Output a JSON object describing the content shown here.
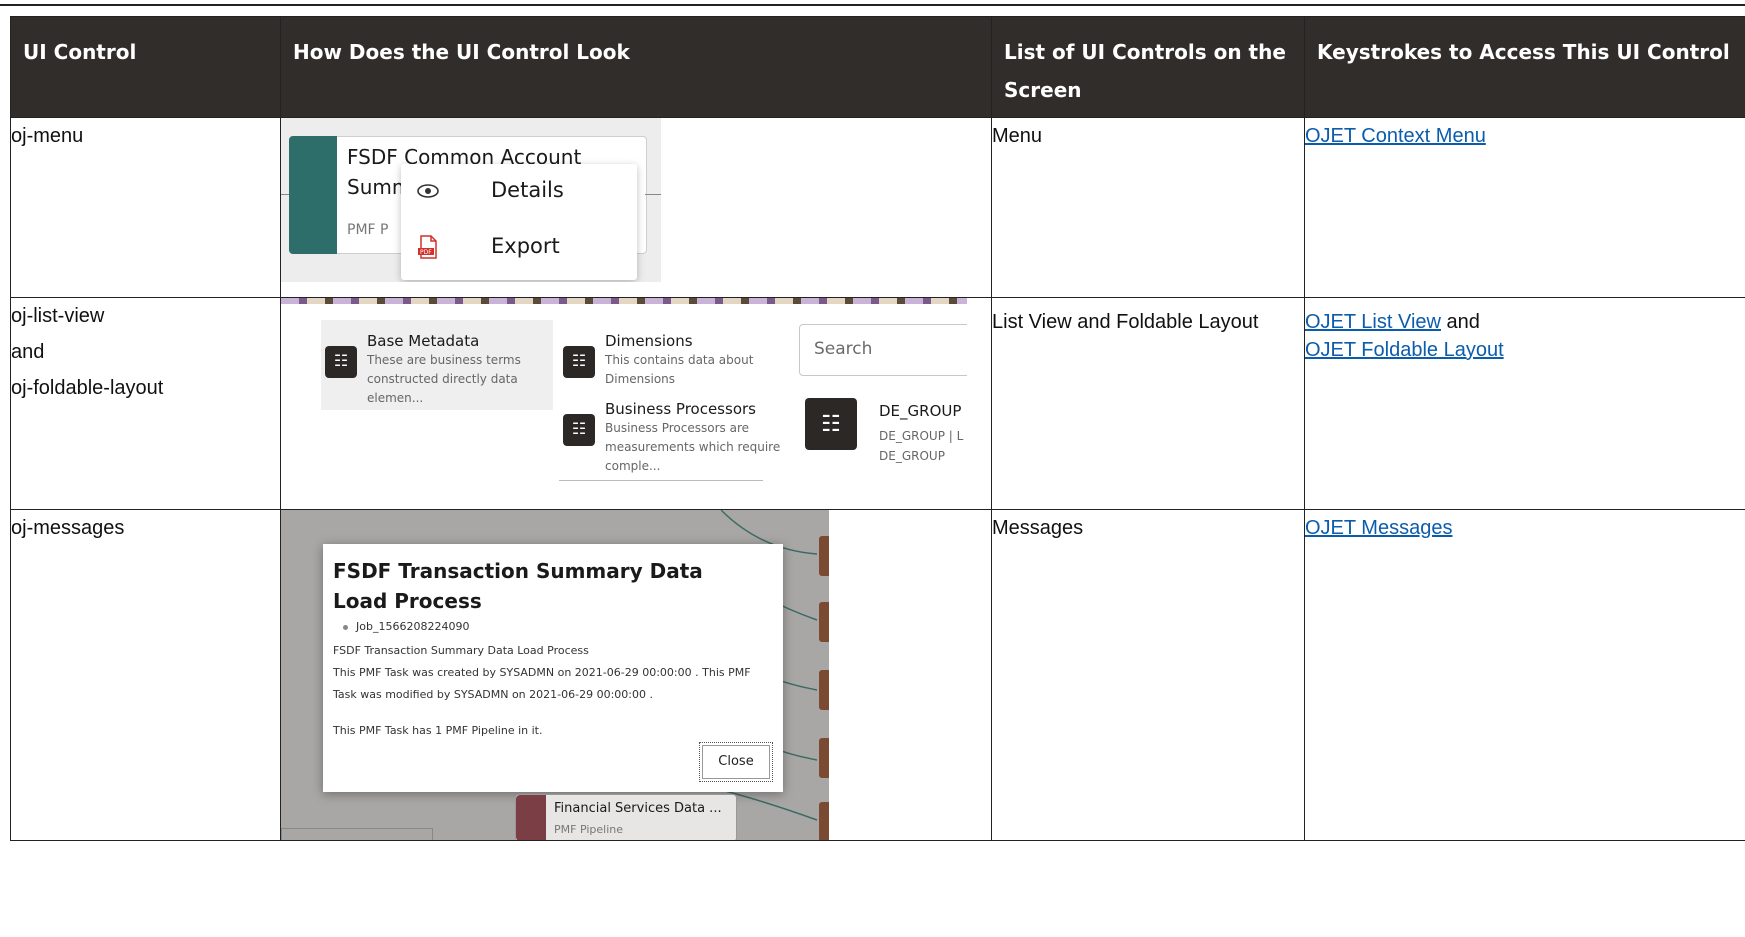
{
  "headers": {
    "control": "UI Control",
    "look": "How Does the UI Control Look",
    "list": "List of UI Controls on the Screen",
    "keys": "Keystrokes to Access This UI Control"
  },
  "rows": [
    {
      "control_lines": [
        "oj-menu"
      ],
      "list_text": "Menu",
      "links": [
        "OJET Context Menu"
      ],
      "shot": {
        "title": "FSDF Common Account Summary",
        "subtitle": "PMF P",
        "menu_items": [
          {
            "label": "Details",
            "icon": "eye-icon"
          },
          {
            "label": "Export",
            "icon": "pdf-icon"
          }
        ]
      }
    },
    {
      "control_lines": [
        "oj-list-view",
        "and",
        "oj-foldable-layout"
      ],
      "list_text": "List View and Foldable Layout",
      "links": [
        "OJET List View",
        "OJET Foldable Layout"
      ],
      "link_joiner": "and",
      "shot": {
        "tiles": [
          {
            "title": "Base Metadata",
            "desc": "These are business terms constructed directly data elemen..."
          },
          {
            "title": "Dimensions",
            "desc": "This contains data about Dimensions"
          },
          {
            "title": "Business Processors",
            "desc": "Business Processors are measurements which require comple..."
          }
        ],
        "search_placeholder": "Search",
        "result_title": "DE_GROUP",
        "result_line1": "DE_GROUP | L",
        "result_line2": "DE_GROUP"
      }
    },
    {
      "control_lines": [
        "oj-messages"
      ],
      "list_text": "Messages",
      "links": [
        "OJET Messages"
      ],
      "shot": {
        "dialog_title": "FSDF Transaction Summary Data Load Process",
        "job": "Job_1566208224090",
        "lines": [
          "FSDF Transaction Summary Data Load Process",
          "This PMF Task was created by SYSADMN on 2021-06-29 00:00:00 .  This PMF",
          "Task was modified by SYSADMN on 2021-06-29 00:00:00 .",
          "",
          "This PMF Task has 1 PMF Pipeline in it."
        ],
        "close_label": "Close",
        "node_title": "Financial Services Data ...",
        "node_sub": "PMF Pipeline"
      }
    }
  ]
}
